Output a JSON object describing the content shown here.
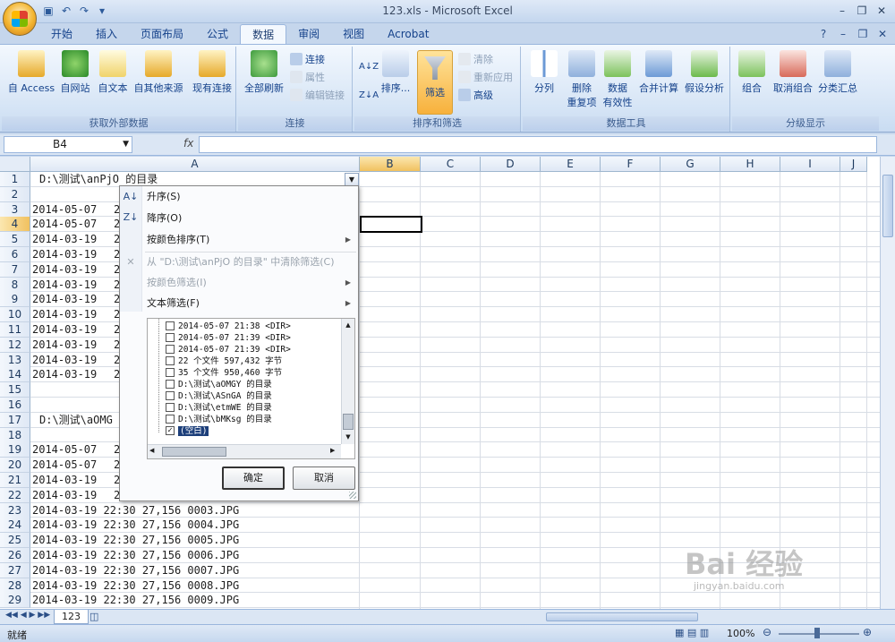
{
  "window": {
    "title": "123.xls - Microsoft Excel"
  },
  "tabs": [
    "开始",
    "插入",
    "页面布局",
    "公式",
    "数据",
    "审阅",
    "视图",
    "Acrobat"
  ],
  "ribbon": {
    "groups": {
      "external": {
        "label": "获取外部数据",
        "buttons": [
          "自 Access",
          "自网站",
          "自文本",
          "自其他来源",
          "现有连接"
        ]
      },
      "connections": {
        "label": "连接",
        "refresh": "全部刷新",
        "connect": "连接",
        "properties": "属性",
        "edit_links": "编辑链接"
      },
      "sort_filter": {
        "label": "排序和筛选",
        "sort": "排序...",
        "filter": "筛选",
        "clear": "清除",
        "reapply": "重新应用",
        "advanced": "高级"
      },
      "data_tools": {
        "label": "数据工具",
        "split": "分列",
        "remove_dup_1": "删除",
        "remove_dup_2": "重复项",
        "validity_1": "数据",
        "validity_2": "有效性",
        "consolidate": "合并计算",
        "whatif": "假设分析"
      },
      "outline": {
        "label": "分级显示",
        "group": "组合",
        "ungroup": "取消组合",
        "subtotal": "分类汇总"
      }
    }
  },
  "formula_bar": {
    "cell_ref": "B4",
    "fx": "fx",
    "value": ""
  },
  "columns": [
    "A",
    "B",
    "C",
    "D",
    "E",
    "F",
    "G",
    "H",
    "I",
    "J"
  ],
  "rows": [
    "1",
    "2",
    "3",
    "4",
    "5",
    "6",
    "7",
    "8",
    "9",
    "10",
    "11",
    "12",
    "13",
    "14",
    "15",
    "16",
    "17",
    "18",
    "19",
    "20",
    "21",
    "22",
    "23",
    "24",
    "25",
    "26",
    "27",
    "28",
    "29"
  ],
  "cells": {
    "r1": "D:\\测试\\anPjO 的目录",
    "r3": "2014-05-07",
    "r4": "2014-05-07",
    "r5": "2014-03-19",
    "r6": "2014-03-19",
    "r7": "2014-03-19",
    "r8": "2014-03-19",
    "r9": "2014-03-19",
    "r10": "2014-03-19",
    "r11": "2014-03-19",
    "r12": "2014-03-19",
    "r13": "2014-03-19",
    "r14": "2014-03-19",
    "r17": "D:\\测试\\aOMG",
    "r19": "2014-05-07",
    "r20": "2014-05-07",
    "r21": "2014-03-19",
    "r22": "2014-03-19",
    "r23": "2014-03-19  22:30            27,156 0003.JPG",
    "r24": "2014-03-19  22:30            27,156 0004.JPG",
    "r25": "2014-03-19  22:30            27,156 0005.JPG",
    "r26": "2014-03-19  22:30            27,156 0006.JPG",
    "r27": "2014-03-19  22:30            27,156 0007.JPG",
    "r28": "2014-03-19  22:30            27,156 0008.JPG",
    "r29": "2014-03-19  22:30            27,156 0009.JPG",
    "partial": "2"
  },
  "filter_menu": {
    "sort_asc": "升序(S)",
    "sort_desc": "降序(O)",
    "sort_color": "按颜色排序(T)",
    "clear_filter": "从 \"D:\\测试\\anPjO 的目录\" 中清除筛选(C)",
    "filter_color": "按颜色筛选(I)",
    "text_filter": "文本筛选(F)",
    "list": [
      {
        "text": "2014-05-07   21:38     <DIR>",
        "checked": false
      },
      {
        "text": "2014-05-07   21:39     <DIR>",
        "checked": false
      },
      {
        "text": "2014-05-07   21:39     <DIR>",
        "checked": false
      },
      {
        "text": "22 个文件        597,432 字节",
        "checked": false
      },
      {
        "text": "35 个文件        950,460 字节",
        "checked": false
      },
      {
        "text": "D:\\测试\\aOMGY 的目录",
        "checked": false
      },
      {
        "text": "D:\\测试\\ASnGA 的目录",
        "checked": false
      },
      {
        "text": "D:\\测试\\etmWE 的目录",
        "checked": false
      },
      {
        "text": "D:\\测试\\bMKsg 的目录",
        "checked": false
      },
      {
        "text": "(空白)",
        "checked": true
      }
    ],
    "ok": "确定",
    "cancel": "取消"
  },
  "sheet": {
    "tab": "123"
  },
  "status": {
    "ready": "就绪",
    "zoom": "100%"
  },
  "watermark": {
    "main": "Bai 经验",
    "url": "jingyan.baidu.com"
  }
}
